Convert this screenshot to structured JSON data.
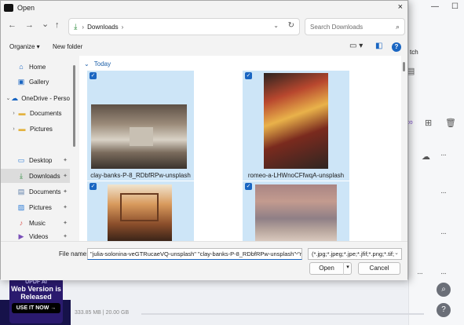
{
  "dialog": {
    "title": "Open",
    "close_icon": "×"
  },
  "nav": {
    "back_icon": "←",
    "forward_icon": "→",
    "recent_icon": "⌄",
    "up_icon": "↑",
    "address": "Downloads",
    "address_chevron": "›",
    "refresh_icon": "↻",
    "search_placeholder": "Search Downloads",
    "search_icon": "⌕"
  },
  "commandbar": {
    "organize": "Organize ▾",
    "new_folder": "New folder"
  },
  "sidebar": {
    "items": [
      {
        "label": "Home",
        "icon": "home-icon"
      },
      {
        "label": "Gallery",
        "icon": "gallery-icon"
      },
      {
        "label": "OneDrive - Perso",
        "icon": "onedrive-icon"
      },
      {
        "label": "Documents",
        "icon": "folder-icon"
      },
      {
        "label": "Pictures",
        "icon": "folder-icon"
      },
      {
        "label": "Desktop",
        "icon": "desktop-icon"
      },
      {
        "label": "Downloads",
        "icon": "download-icon"
      },
      {
        "label": "Documents",
        "icon": "documents-icon"
      },
      {
        "label": "Pictures",
        "icon": "pictures-icon"
      },
      {
        "label": "Music",
        "icon": "music-icon"
      },
      {
        "label": "Videos",
        "icon": "videos-icon"
      }
    ]
  },
  "content": {
    "group": "Today",
    "files": [
      {
        "name": "clay-banks-P-8_RDbfRPw-unsplash",
        "selected": true
      },
      {
        "name": "romeo-a-LHWnoCFfwqA-unsplash",
        "selected": true
      },
      {
        "name": "",
        "selected": true
      },
      {
        "name": "",
        "selected": true
      }
    ]
  },
  "footer": {
    "file_name_label": "File name:",
    "file_name_value": "\"julia-solonina-veGTRucaeVQ-unsplash\" \"clay-banks-P-8_RDbfRPw-unsplash\" \"r",
    "filter_value": "(*.jpg;*.jpeg;*.jpe;*.jfif;*.png;*.tif;",
    "open_label": "Open",
    "cancel_label": "Cancel"
  },
  "background_app": {
    "partial_text_1": "tch",
    "promo_title": "UPDF AI",
    "promo_main": "Web Version is Released",
    "promo_button": "USE IT NOW →",
    "storage_status": "333.85 MB | 20.00 GB"
  },
  "colors": {
    "accent": "#1a66c2",
    "selection": "#cde5f7",
    "promo_bg": "#2a1a6e"
  }
}
